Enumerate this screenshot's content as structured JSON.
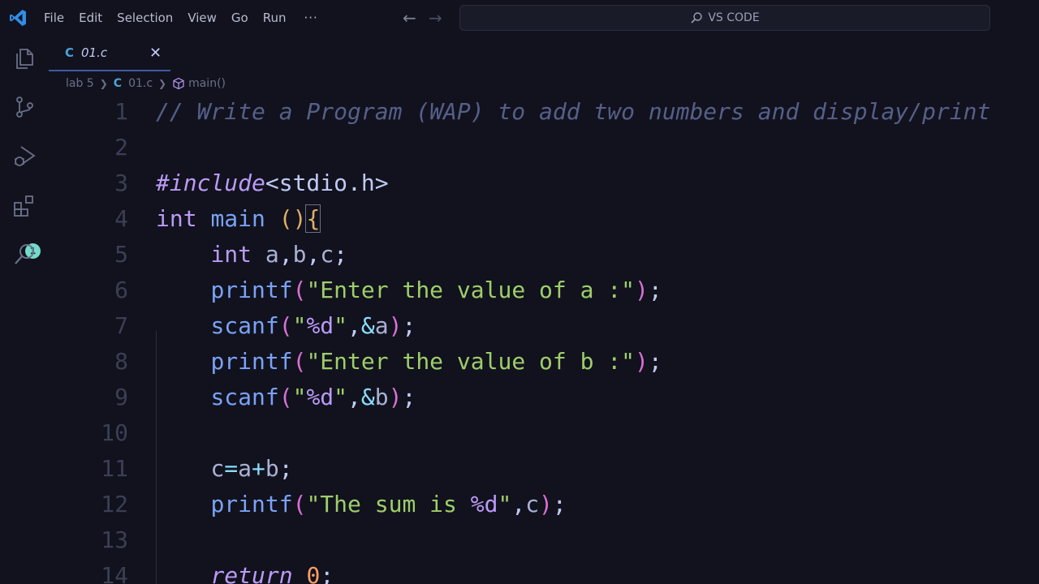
{
  "titlebar": {
    "menu": [
      "File",
      "Edit",
      "Selection",
      "View",
      "Go",
      "Run"
    ],
    "more": "···",
    "back": "←",
    "forward": "→",
    "search_label": "VS CODE"
  },
  "activity": {
    "badge_count": "1"
  },
  "tab": {
    "lang": "C",
    "name": "01.c",
    "close": "✕"
  },
  "breadcrumb": {
    "folder": "lab 5",
    "lang": "C",
    "file": "01.c",
    "symbol": "main()"
  },
  "editor": {
    "line_numbers": [
      "1",
      "2",
      "3",
      "4",
      "5",
      "6",
      "7",
      "8",
      "9",
      "10",
      "11",
      "12",
      "13",
      "14"
    ],
    "lines": [
      "// Write a Program (WAP) to add two numbers and display/print",
      "",
      "#include<stdio.h>",
      "int main (){",
      "    int a,b,c;",
      "    printf(\"Enter the value of a :\");",
      "    scanf(\"%d\",&a);",
      "    printf(\"Enter the value of b :\");",
      "    scanf(\"%d\",&b);",
      "",
      "    c=a+b;",
      "    printf(\"The sum is %d\",c);",
      "",
      "    return 0;"
    ]
  },
  "colors": {
    "background": "#11121d",
    "comment": "#565f89",
    "keyword": "#bb9af7",
    "function": "#7aa2f7",
    "string": "#9ece6a",
    "number": "#ff9e64",
    "accent": "#3d59a1",
    "badge": "#73daca"
  }
}
